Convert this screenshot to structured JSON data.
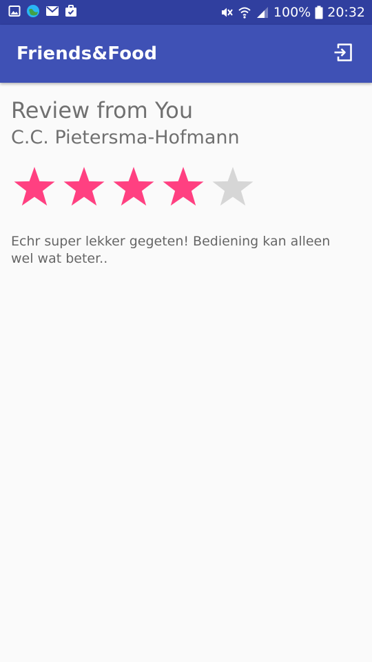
{
  "status_bar": {
    "battery_text": "100%",
    "time": "20:32",
    "left_icons": [
      "gallery-icon",
      "globe-app-icon",
      "gmail-icon",
      "briefcase-icon"
    ],
    "right_icons": [
      "muted-icon",
      "wifi-icon",
      "signal-icon",
      "battery-icon"
    ]
  },
  "app_bar": {
    "title": "Friends&Food",
    "action_icon": "logout-icon",
    "background": "#3f51b5",
    "status_background": "#303f9f"
  },
  "review": {
    "heading": "Review from You",
    "author": "C.C. Pietersma-Hofmann",
    "rating": 4,
    "max_rating": 5,
    "filled_star_color": "#ff4081",
    "empty_star_color": "#d6d6d6",
    "text": "Echr super lekker gegeten! Bediening kan alleen wel wat beter.."
  }
}
